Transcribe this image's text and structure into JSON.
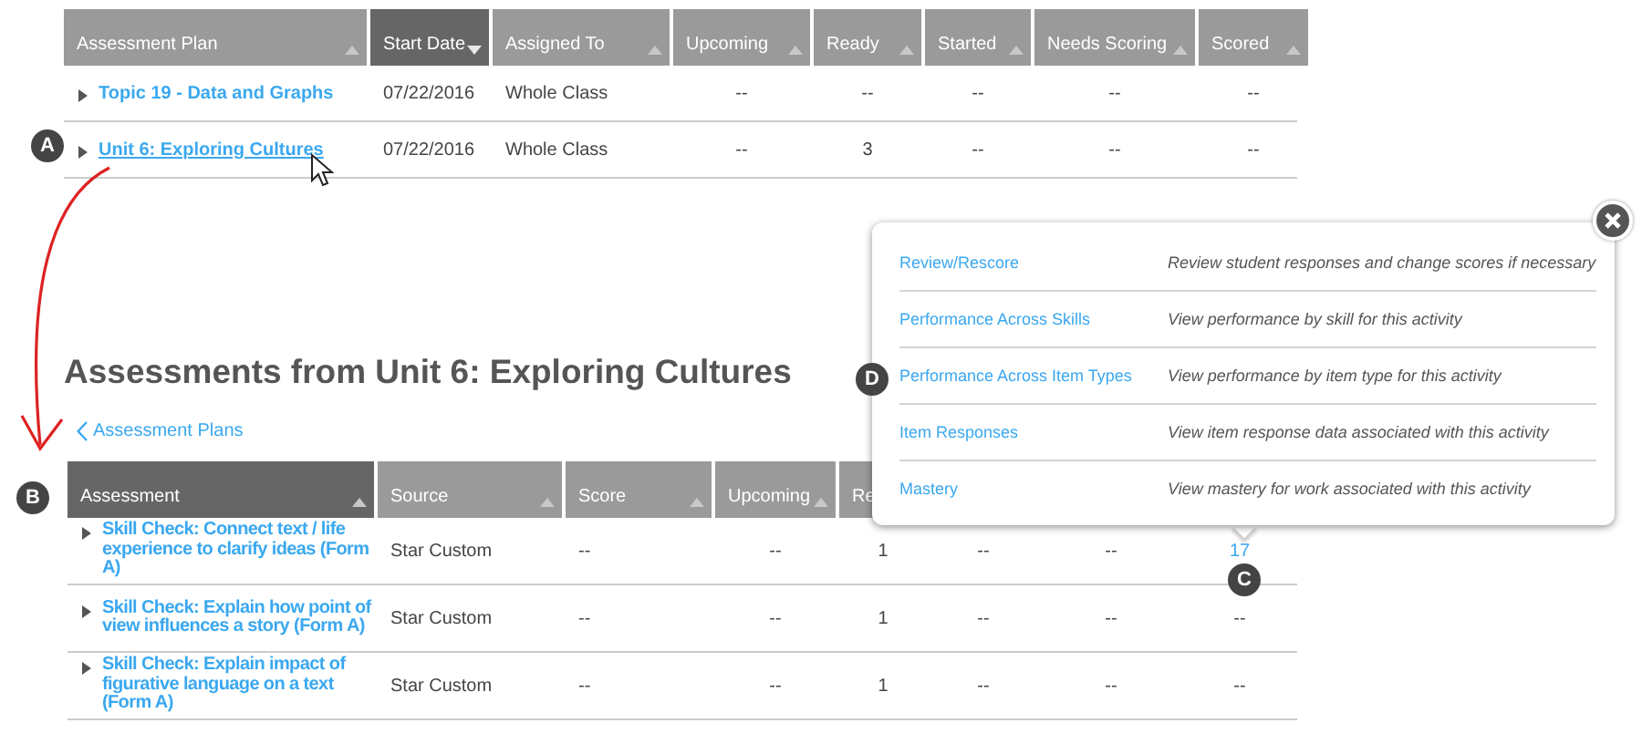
{
  "plans_table": {
    "columns": [
      {
        "label": "Assessment Plan",
        "selected": false,
        "sort_descending": false
      },
      {
        "label": "Start Date",
        "selected": true,
        "sort_descending": true
      },
      {
        "label": "Assigned To",
        "selected": false,
        "sort_descending": false
      },
      {
        "label": "Upcoming",
        "selected": false,
        "sort_descending": false
      },
      {
        "label": "Ready",
        "selected": false,
        "sort_descending": false
      },
      {
        "label": "Started",
        "selected": false,
        "sort_descending": false
      },
      {
        "label": "Needs Scoring",
        "selected": false,
        "sort_descending": false
      },
      {
        "label": "Scored",
        "selected": false,
        "sort_descending": false
      }
    ],
    "rows": [
      {
        "hovered": false,
        "expanded": false,
        "cells": [
          "Topic 19 - Data and Graphs",
          "07/22/2016",
          "Whole Class",
          "--",
          "--",
          "--",
          "--",
          "--"
        ]
      },
      {
        "hovered": true,
        "expanded": false,
        "cells": [
          "Unit 6: Exploring Cultures",
          "07/22/2016",
          "Whole Class",
          "--",
          "3",
          "--",
          "--",
          "--"
        ]
      }
    ]
  },
  "heading": "Assessments from Unit 6: Exploring Cultures",
  "back_link": "Assessment Plans",
  "assessments_table": {
    "columns": [
      {
        "label": "Assessment",
        "selected": true,
        "sort_descending": false
      },
      {
        "label": "Source",
        "selected": false,
        "sort_descending": false
      },
      {
        "label": "Score",
        "selected": false,
        "sort_descending": false
      },
      {
        "label": "Upcoming",
        "selected": false,
        "sort_descending": false
      },
      {
        "label": "Re",
        "selected": false
      }
    ],
    "rows": [
      {
        "expanded": false,
        "scored_link": true,
        "cells": [
          "Skill Check: Connect text / life experience to clarify ideas (Form A)",
          "Star Custom",
          "--",
          "--",
          "1",
          "--",
          "--",
          "17"
        ]
      },
      {
        "expanded": false,
        "scored_link": false,
        "cells": [
          "Skill Check: Explain how point of view influences a story (Form A)",
          "Star Custom",
          "--",
          "--",
          "1",
          "--",
          "--",
          "--"
        ]
      },
      {
        "expanded": false,
        "scored_link": false,
        "cells": [
          "Skill Check: Explain impact of figurative language on a text (Form A)",
          "Star Custom",
          "--",
          "--",
          "1",
          "--",
          "--",
          "--"
        ]
      }
    ]
  },
  "popup": {
    "items": [
      {
        "link": "Review/Rescore",
        "description": "Review student responses and change scores if necessary"
      },
      {
        "link": "Performance Across Skills",
        "description": "View performance by skill for this activity"
      },
      {
        "link": "Performance Across Item Types",
        "description": "View performance by item type for this activity"
      },
      {
        "link": "Item Responses",
        "description": "View item response data associated with this activity"
      },
      {
        "link": "Mastery",
        "description": "View mastery for work associated with this activity"
      }
    ]
  },
  "callouts": [
    {
      "letter": "A"
    },
    {
      "letter": "B"
    },
    {
      "letter": "C"
    },
    {
      "letter": "D"
    }
  ]
}
